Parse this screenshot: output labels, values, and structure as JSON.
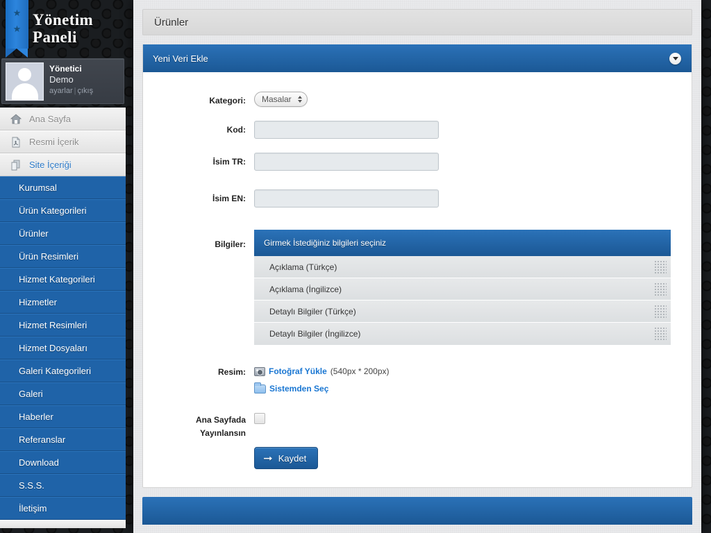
{
  "brand": {
    "line1": "Yönetim",
    "line2": "Paneli",
    "star": "★"
  },
  "profile": {
    "name": "Yönetici",
    "role": "Demo",
    "settings_link": "ayarlar",
    "logout_link": "çıkış",
    "separator": "|"
  },
  "sidebar": {
    "top_items": [
      {
        "label": "Ana Sayfa",
        "icon": "home-icon",
        "active": false
      },
      {
        "label": "Resmi İçerik",
        "icon": "pdf-file-icon",
        "active": false
      },
      {
        "label": "Site İçeriği",
        "icon": "pages-icon",
        "active": true
      }
    ],
    "sub_items": [
      {
        "label": "Kurumsal"
      },
      {
        "label": "Ürün Kategorileri"
      },
      {
        "label": "Ürünler"
      },
      {
        "label": "Ürün Resimleri"
      },
      {
        "label": "Hizmet Kategorileri"
      },
      {
        "label": "Hizmetler"
      },
      {
        "label": "Hizmet Resimleri"
      },
      {
        "label": "Hizmet Dosyaları"
      },
      {
        "label": "Galeri Kategorileri"
      },
      {
        "label": "Galeri"
      },
      {
        "label": "Haberler"
      },
      {
        "label": "Referanslar"
      },
      {
        "label": "Download"
      },
      {
        "label": "S.S.S."
      },
      {
        "label": "İletişim"
      }
    ]
  },
  "page": {
    "title": "Ürünler"
  },
  "panel": {
    "title": "Yeni Veri Ekle",
    "collapse_icon": "chevron-down-icon"
  },
  "form": {
    "category": {
      "label": "Kategori:",
      "selected": "Masalar"
    },
    "code": {
      "label": "Kod:",
      "value": "",
      "placeholder": ""
    },
    "name_tr": {
      "label": "İsim TR:",
      "value": "",
      "placeholder": ""
    },
    "name_en": {
      "label": "İsim EN:",
      "value": "",
      "placeholder": ""
    },
    "info": {
      "label": "Bilgiler:",
      "header": "Girmek İstediğiniz bilgileri seçiniz",
      "items": [
        {
          "label": "Açıklama (Türkçe)"
        },
        {
          "label": "Açıklama (İngilizce)"
        },
        {
          "label": "Detaylı Bilgiler (Türkçe)"
        },
        {
          "label": "Detaylı Bilgiler (İngilizce)"
        }
      ]
    },
    "image": {
      "label": "Resim:",
      "upload_link": "Fotoğraf Yükle",
      "dimensions": "(540px * 200px)",
      "select_link": "Sistemden Seç"
    },
    "homepage": {
      "label_line1": "Ana Sayfada",
      "label_line2": "Yayınlansın",
      "checked": false
    },
    "save": {
      "label": "Kaydet",
      "icon": "arrow-right-icon"
    }
  },
  "colors": {
    "accent_blue": "#1f63a8",
    "panel_header_blue": "#2b72b8",
    "link_blue": "#1976d2",
    "sidebar_dark": "#373c44"
  }
}
